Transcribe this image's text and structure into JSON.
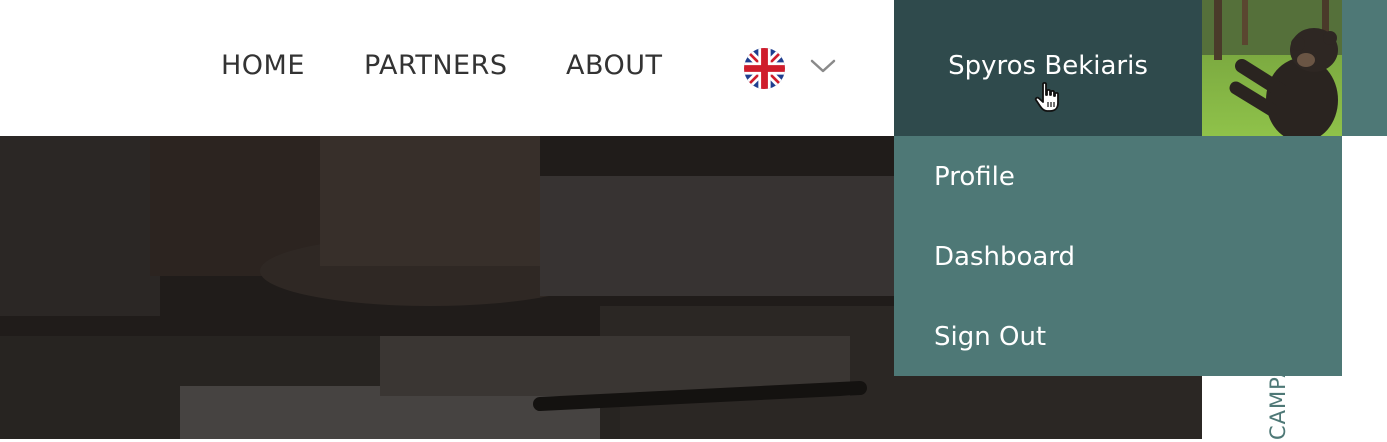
{
  "nav": {
    "home": "HOME",
    "partners": "PARTNERS",
    "about": "ABOUT"
  },
  "language": {
    "flag_icon": "uk-flag-icon",
    "caret_icon": "chevron-down-icon"
  },
  "user": {
    "name": "Spyros Bekiaris",
    "avatar_icon": "bear-avatar"
  },
  "dropdown": {
    "items": [
      "Profile",
      "Dashboard",
      "Sign Out"
    ]
  },
  "side_label": "CAMPA",
  "colors": {
    "user_block": "#2f4a4c",
    "dropdown": "#4e7876",
    "nav_text": "#333333"
  }
}
